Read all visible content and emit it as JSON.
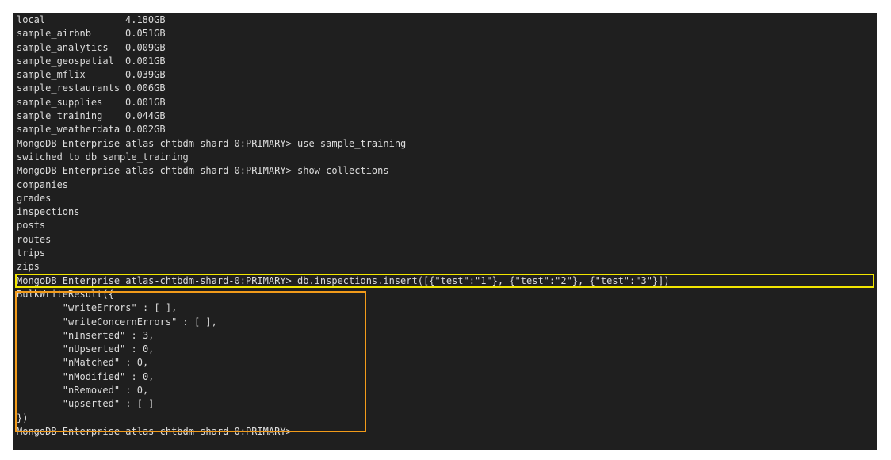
{
  "terminal": {
    "db_sizes": [
      {
        "name": "local",
        "size": "4.180GB"
      },
      {
        "name": "sample_airbnb",
        "size": "0.051GB"
      },
      {
        "name": "sample_analytics",
        "size": "0.009GB"
      },
      {
        "name": "sample_geospatial",
        "size": "0.001GB"
      },
      {
        "name": "sample_mflix",
        "size": "0.039GB"
      },
      {
        "name": "sample_restaurants",
        "size": "0.006GB"
      },
      {
        "name": "sample_supplies",
        "size": "0.001GB"
      },
      {
        "name": "sample_training",
        "size": "0.044GB"
      },
      {
        "name": "sample_weatherdata",
        "size": "0.002GB"
      }
    ],
    "lines": [
      "MongoDB Enterprise atlas-chtbdm-shard-0:PRIMARY> use sample_training",
      "switched to db sample_training",
      "MongoDB Enterprise atlas-chtbdm-shard-0:PRIMARY> show collections",
      "companies",
      "grades",
      "inspections",
      "posts",
      "routes",
      "trips",
      "zips",
      "MongoDB Enterprise atlas-chtbdm-shard-0:PRIMARY> db.inspections.insert([{\"test\":\"1\"}, {\"test\":\"2\"}, {\"test\":\"3\"}])",
      "BulkWriteResult({",
      "        \"writeErrors\" : [ ],",
      "        \"writeConcernErrors\" : [ ],",
      "        \"nInserted\" : 3,",
      "        \"nUpserted\" : 0,",
      "        \"nMatched\" : 0,",
      "        \"nModified\" : 0,",
      "        \"nRemoved\" : 0,",
      "        \"upserted\" : [ ]",
      "})",
      "MongoDB Enterprise atlas-chtbdm-shard-0:PRIMARY>"
    ]
  },
  "highlights": {
    "command_color": "#f2e600",
    "result_color": "#f29b1a"
  }
}
